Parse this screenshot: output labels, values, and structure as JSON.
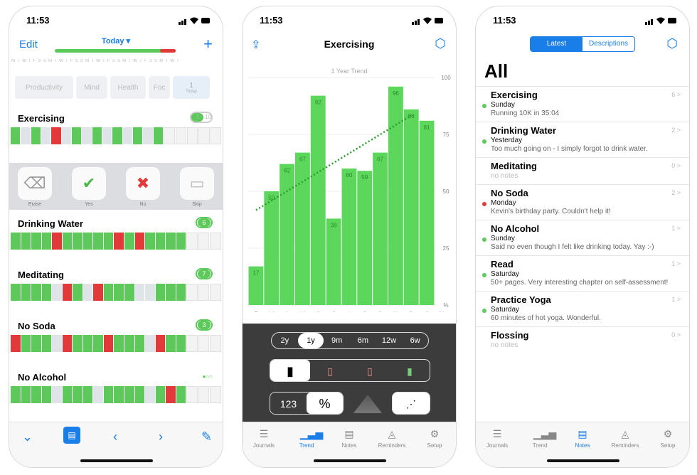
{
  "status": {
    "time": "11:53"
  },
  "phone1": {
    "nav": {
      "edit": "Edit",
      "title": "Today ▾",
      "plus": "+"
    },
    "days": "MTWTFSSMTWTFSSMTWTFSSMTWTFSSMTWT",
    "categories": [
      "Productivity",
      "Mind",
      "Health",
      "Foc",
      "1"
    ],
    "category_sub": "Today",
    "habits": [
      {
        "name": "Exercising",
        "count": "7",
        "total": "10"
      },
      {
        "name": "Drinking Water",
        "count": "6"
      },
      {
        "name": "Meditating",
        "count": "7"
      },
      {
        "name": "No Soda",
        "count": "3"
      },
      {
        "name": "No Alcohol",
        "count": ""
      }
    ],
    "actions": [
      {
        "label": "Erase",
        "icon": "⌫"
      },
      {
        "label": "Yes",
        "icon": "✔"
      },
      {
        "label": "No",
        "icon": "✖"
      },
      {
        "label": "Skip",
        "icon": "▭"
      }
    ]
  },
  "phone2": {
    "title": "Exercising",
    "chart_data": {
      "type": "bar",
      "title": "1 Year Trend",
      "categories": [
        "F",
        "M",
        "A",
        "M",
        "J",
        "J",
        "A",
        "S",
        "O",
        "N",
        "D",
        "J"
      ],
      "values": [
        17,
        50,
        62,
        67,
        92,
        38,
        60,
        59,
        67,
        96,
        86,
        81
      ],
      "ylim": [
        0,
        100
      ],
      "yticks": [
        "100",
        "75",
        "50",
        "25",
        "%"
      ],
      "trend": "dotted linear trendline"
    },
    "close": "×",
    "ranges": [
      "2y",
      "1y",
      "9m",
      "6m",
      "12w",
      "6w"
    ],
    "range_selected": "1y",
    "numeric_label": "123",
    "percent_label": "%"
  },
  "phone3": {
    "segments": [
      "Latest",
      "Descriptions"
    ],
    "heading": "All",
    "items": [
      {
        "name": "Exercising",
        "day": "Sunday",
        "note": "Running 10K in 35:04",
        "count": "6 >",
        "status": "green"
      },
      {
        "name": "Drinking Water",
        "day": "Yesterday",
        "note": "Too much going on - I simply forgot to drink water.",
        "count": "2 >",
        "status": "green"
      },
      {
        "name": "Meditating",
        "day": "",
        "note": "no notes",
        "count": "0 >",
        "status": "none"
      },
      {
        "name": "No Soda",
        "day": "Monday",
        "note": "Kevin's birthday party. Couldn't help it!",
        "count": "2 >",
        "status": "red"
      },
      {
        "name": "No Alcohol",
        "day": "Sunday",
        "note": "Said no even though I felt like drinking today. Yay :-)",
        "count": "1 >",
        "status": "green"
      },
      {
        "name": "Read",
        "day": "Saturday",
        "note": "50+ pages. Very interesting chapter on self-assessment!",
        "count": "1 >",
        "status": "green"
      },
      {
        "name": "Practice Yoga",
        "day": "Saturday",
        "note": "60 minutes of hot yoga. Wonderful.",
        "count": "1 >",
        "status": "green"
      },
      {
        "name": "Flossing",
        "day": "",
        "note": "no notes",
        "count": "0 >",
        "status": "none"
      }
    ]
  },
  "tabs": [
    "Journals",
    "Trend",
    "Notes",
    "Reminders",
    "Setup"
  ]
}
